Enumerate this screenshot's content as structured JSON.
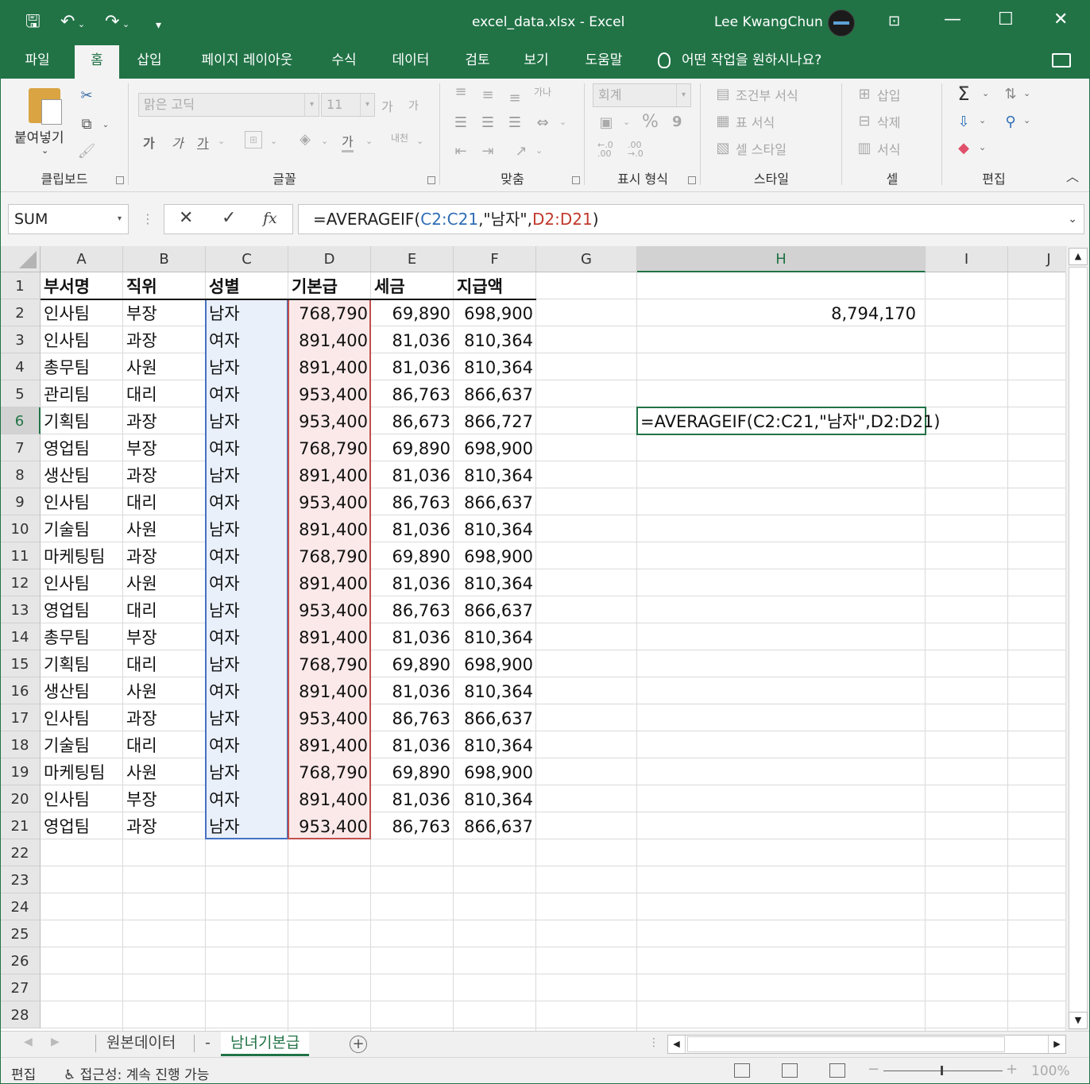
{
  "titlebar": {
    "save_icon": "save-icon",
    "undo_icon": "undo-icon",
    "redo_icon": "redo-icon",
    "customize_icon": "customize-qat-icon",
    "title": "excel_data.xlsx  -  Excel",
    "user": "Lee KwangChun",
    "ribbon_display_icon": "ribbon-display-options-icon",
    "minimize": "—",
    "maximize": "☐",
    "close": "✕",
    "accent": "#217346"
  },
  "tabs": [
    "파일",
    "홈",
    "삽입",
    "페이지 레이아웃",
    "수식",
    "데이터",
    "검토",
    "보기",
    "도움말"
  ],
  "active_tab": "홈",
  "tell_me": "어떤 작업을 원하시나요?",
  "ribbon": {
    "clipboard": {
      "label": "클립보드",
      "paste": "붙여넣기"
    },
    "font": {
      "label": "글꼴",
      "font_name": "맑은 고딕",
      "font_size": "11",
      "grow": "가",
      "shrink": "가",
      "bold": "가",
      "italic": "가",
      "underline": "가",
      "font_color": "가",
      "phonetic": "내천"
    },
    "alignment": {
      "label": "맞춤",
      "wrap": "가나"
    },
    "number": {
      "label": "표시 형식",
      "format": "회계",
      "percent": "%",
      "comma": "9",
      "inc_decimal": "←.0\n.00",
      "dec_decimal": ".00\n→.0"
    },
    "styles": {
      "label": "스타일",
      "conditional": "조건부 서식",
      "table": "표 서식",
      "cell_styles": "셀 스타일"
    },
    "cells": {
      "label": "셀",
      "insert": "삽입",
      "delete": "삭제",
      "format": "서식"
    },
    "editing": {
      "label": "편집"
    }
  },
  "formula_bar": {
    "name_box": "SUM",
    "cancel": "✕",
    "enter": "✓",
    "fx": "fx",
    "formula_prefix": "=AVERAGEIF(",
    "formula_ref1": "C2:C21",
    "formula_mid": ",\"남자\",",
    "formula_ref2": "D2:D21",
    "formula_suffix": ")"
  },
  "columns": [
    "A",
    "B",
    "C",
    "D",
    "E",
    "F",
    "G",
    "H",
    "I",
    "J"
  ],
  "selected_column": "H",
  "rows": [
    "1",
    "2",
    "3",
    "4",
    "5",
    "6",
    "7",
    "8",
    "9",
    "10",
    "11",
    "12",
    "13",
    "14",
    "15",
    "16",
    "17",
    "18",
    "19",
    "20",
    "21",
    "22",
    "23",
    "24",
    "25",
    "26",
    "27",
    "28"
  ],
  "selected_row": "6",
  "table": {
    "headers": [
      "부서명",
      "직위",
      "성별",
      "기본급",
      "세금",
      "지급액"
    ],
    "rows": [
      [
        "인사팀",
        "부장",
        "남자",
        "768,790",
        "69,890",
        "698,900"
      ],
      [
        "인사팀",
        "과장",
        "여자",
        "891,400",
        "81,036",
        "810,364"
      ],
      [
        "총무팀",
        "사원",
        "남자",
        "891,400",
        "81,036",
        "810,364"
      ],
      [
        "관리팀",
        "대리",
        "여자",
        "953,400",
        "86,763",
        "866,637"
      ],
      [
        "기획팀",
        "과장",
        "남자",
        "953,400",
        "86,673",
        "866,727"
      ],
      [
        "영업팀",
        "부장",
        "여자",
        "768,790",
        "69,890",
        "698,900"
      ],
      [
        "생산팀",
        "과장",
        "남자",
        "891,400",
        "81,036",
        "810,364"
      ],
      [
        "인사팀",
        "대리",
        "여자",
        "953,400",
        "86,763",
        "866,637"
      ],
      [
        "기술팀",
        "사원",
        "남자",
        "891,400",
        "81,036",
        "810,364"
      ],
      [
        "마케팅팀",
        "과장",
        "여자",
        "768,790",
        "69,890",
        "698,900"
      ],
      [
        "인사팀",
        "사원",
        "여자",
        "891,400",
        "81,036",
        "810,364"
      ],
      [
        "영업팀",
        "대리",
        "남자",
        "953,400",
        "86,763",
        "866,637"
      ],
      [
        "총무팀",
        "부장",
        "여자",
        "891,400",
        "81,036",
        "810,364"
      ],
      [
        "기획팀",
        "대리",
        "남자",
        "768,790",
        "69,890",
        "698,900"
      ],
      [
        "생산팀",
        "사원",
        "여자",
        "891,400",
        "81,036",
        "810,364"
      ],
      [
        "인사팀",
        "과장",
        "남자",
        "953,400",
        "86,763",
        "866,637"
      ],
      [
        "기술팀",
        "대리",
        "여자",
        "891,400",
        "81,036",
        "810,364"
      ],
      [
        "마케팅팀",
        "사원",
        "남자",
        "768,790",
        "69,890",
        "698,900"
      ],
      [
        "인사팀",
        "부장",
        "여자",
        "891,400",
        "81,036",
        "810,364"
      ],
      [
        "영업팀",
        "과장",
        "남자",
        "953,400",
        "86,763",
        "866,637"
      ]
    ]
  },
  "cell_H2": "8,794,170",
  "cell_H6_edit": "=AVERAGEIF(C2:C21,\"남자\",D2:D21)",
  "sheets": [
    "원본데이터",
    "-",
    "남녀기본급"
  ],
  "active_sheet": "남녀기본급",
  "status": {
    "mode": "편집",
    "accessibility": "접근성: 계속 진행 가능",
    "zoom": "100%",
    "zoom_minus": "−",
    "zoom_plus": "+"
  }
}
